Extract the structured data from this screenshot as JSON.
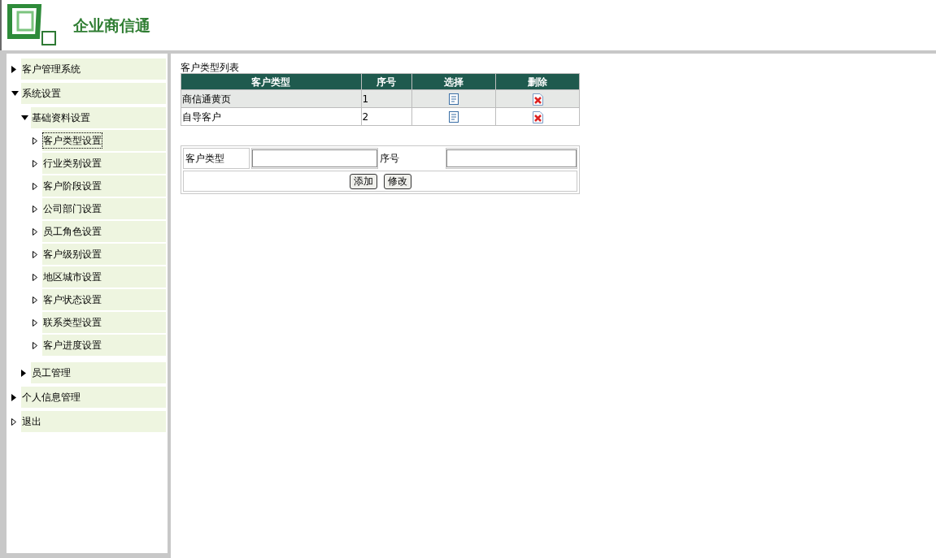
{
  "header": {
    "logo_text": "企业商信通"
  },
  "sidebar": {
    "items": [
      {
        "label": "客户管理系统",
        "kind": "branch",
        "expanded": false,
        "selected": false
      },
      {
        "label": "系统设置",
        "kind": "branch",
        "expanded": true,
        "selected": false,
        "children": [
          {
            "label": "基础资料设置",
            "kind": "branch",
            "expanded": true,
            "selected": false,
            "children": [
              {
                "label": "客户类型设置",
                "selected": true
              },
              {
                "label": "行业类别设置",
                "selected": false
              },
              {
                "label": "客户阶段设置",
                "selected": false
              },
              {
                "label": "公司部门设置",
                "selected": false
              },
              {
                "label": "员工角色设置",
                "selected": false
              },
              {
                "label": "客户级别设置",
                "selected": false
              },
              {
                "label": "地区城市设置",
                "selected": false
              },
              {
                "label": "客户状态设置",
                "selected": false
              },
              {
                "label": "联系类型设置",
                "selected": false
              },
              {
                "label": "客户进度设置",
                "selected": false
              }
            ]
          },
          {
            "label": "员工管理",
            "kind": "branch",
            "expanded": false,
            "selected": false
          }
        ]
      },
      {
        "label": "个人信息管理",
        "kind": "branch",
        "expanded": false,
        "selected": false
      },
      {
        "label": "退出",
        "selected": false
      }
    ]
  },
  "table": {
    "caption": "客户类型列表",
    "columns": [
      "客户类型",
      "序号",
      "选择",
      "删除"
    ],
    "rows": [
      {
        "type": "商信通黄页",
        "number": "1"
      },
      {
        "type": "自导客户",
        "number": "2"
      }
    ]
  },
  "form": {
    "type_label": "客户类型",
    "number_label": "序号",
    "buttons": [
      "添加",
      "修改"
    ]
  }
}
